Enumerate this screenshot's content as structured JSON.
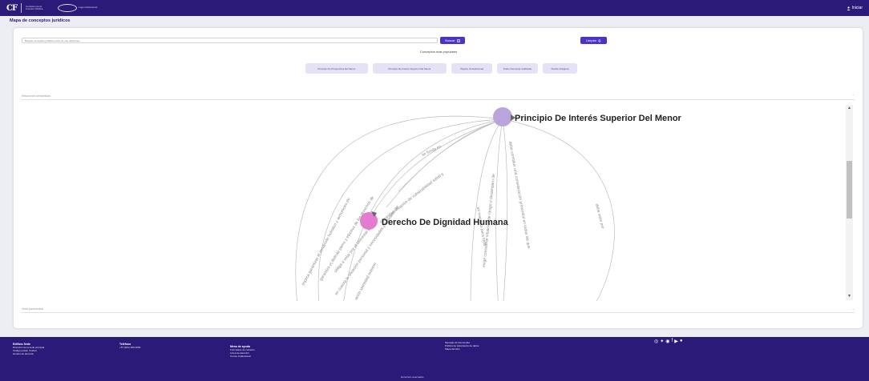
{
  "header": {
    "logo_abbr": "CF",
    "logo_text": "Comisión de la Función Pública",
    "logo2_text": "Logo institucional",
    "login_label": "Iniciar"
  },
  "page_title": "Mapa de conceptos jurídicos",
  "search": {
    "placeholder": "Busque conceptos jurídicos para ver sus relaciones",
    "button_label": "Buscar",
    "clear_label": "Limpiar"
  },
  "popular": {
    "title": "Conceptos más populares",
    "chips": [
      "Principio De Prospectiva Del Menor",
      "Principio De Interés Superior Del Menor",
      "Órgano Jurisdiccional",
      "Poder Personas Calificado",
      "Pueblo Indígena"
    ]
  },
  "sections": {
    "semantic": "Relaciones semánticas",
    "other": "Vista panorámica"
  },
  "graph": {
    "nodes": [
      {
        "label": "Principio De Interés Superior Del Menor",
        "color": "#b9a4dc"
      },
      {
        "label": "Derecho De Dignidad Humana",
        "color": "#e37ccf"
      }
    ],
    "edges": [
      "implica garantizar el desarrollo holístico y armonioso de",
      "garantiza el disfrute pleno y efectivo de los derechos de",
      "obliga a velar por el bienestar pleno de",
      "en cuenta la situación personal y necesidades personales de",
      "seguridad situación de vulnerabilidad salud y",
      "se funda en",
      "ación identidad entorno",
      "exige considerar situación de riesgo o desamparo de",
      "debe constituir una consideración primordial en todas las que",
      "es mandato para toda",
      "debe velar por"
    ]
  },
  "footer": {
    "col1_title": "Edificio Sede",
    "col1_lines": [
      "Dirección de la sede principal",
      "Código postal, Ciudad",
      "Horario de atención"
    ],
    "col2_title": "Teléfono",
    "col2_lines": [
      "+57 (601) 000 0000"
    ],
    "col3_title": "Mesa de ayuda",
    "col3_lines": [
      "Formulario de contacto",
      "Línea de atención",
      "Correo institucional"
    ],
    "col4_lines": [
      "Mensaje de bienvenida",
      "Política de tratamiento de datos",
      "Mapa del sitio"
    ],
    "copyright": "Derechos reservados"
  },
  "colors": {
    "brand": "#2c1a78",
    "accent": "#4a34c8",
    "node_main": "#b9a4dc",
    "node_secondary": "#e37ccf"
  }
}
